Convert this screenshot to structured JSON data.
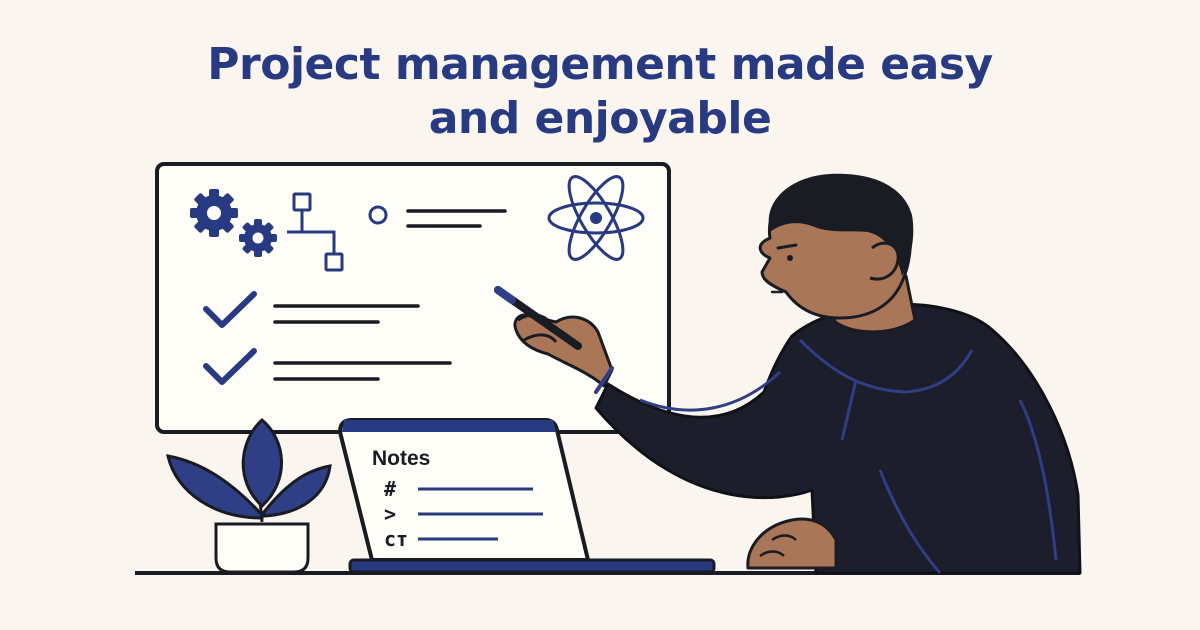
{
  "headline": {
    "line1": "Project management made easy",
    "line2": "and enjoyable"
  },
  "laptop": {
    "title": "Notes",
    "symbols": [
      "#",
      ">",
      "ст"
    ]
  },
  "icons": {
    "gears": "gears-icon",
    "flowchart": "flowchart-icon",
    "atom": "atom-icon",
    "checkmark": "checkmark-icon"
  },
  "colors": {
    "background": "#FAF6EF",
    "navy": "#273A82",
    "ink": "#1A1C24",
    "skin": "#A97757",
    "plant": "#2E3F85",
    "hoodie": "#1C1E2B"
  }
}
